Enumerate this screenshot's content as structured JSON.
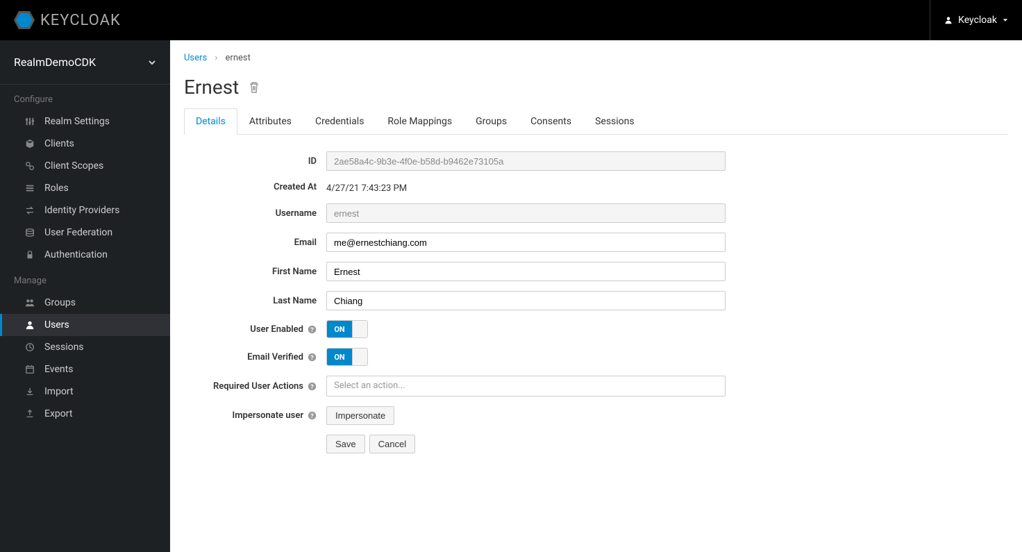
{
  "header": {
    "brand": "KEYCLOAK",
    "user_label": "Keycloak"
  },
  "sidebar": {
    "realm": "RealmDemoCDK",
    "sections": [
      {
        "title": "Configure",
        "items": [
          {
            "label": "Realm Settings",
            "icon": "sliders"
          },
          {
            "label": "Clients",
            "icon": "cube"
          },
          {
            "label": "Client Scopes",
            "icon": "link"
          },
          {
            "label": "Roles",
            "icon": "list"
          },
          {
            "label": "Identity Providers",
            "icon": "exchange"
          },
          {
            "label": "User Federation",
            "icon": "database"
          },
          {
            "label": "Authentication",
            "icon": "lock"
          }
        ]
      },
      {
        "title": "Manage",
        "items": [
          {
            "label": "Groups",
            "icon": "users"
          },
          {
            "label": "Users",
            "icon": "user",
            "active": true
          },
          {
            "label": "Sessions",
            "icon": "clock"
          },
          {
            "label": "Events",
            "icon": "calendar"
          },
          {
            "label": "Import",
            "icon": "import"
          },
          {
            "label": "Export",
            "icon": "export"
          }
        ]
      }
    ]
  },
  "breadcrumb": {
    "parent": "Users",
    "current": "ernest"
  },
  "page": {
    "title": "Ernest"
  },
  "tabs": [
    {
      "label": "Details",
      "active": true
    },
    {
      "label": "Attributes"
    },
    {
      "label": "Credentials"
    },
    {
      "label": "Role Mappings"
    },
    {
      "label": "Groups"
    },
    {
      "label": "Consents"
    },
    {
      "label": "Sessions"
    }
  ],
  "form": {
    "labels": {
      "id": "ID",
      "created_at": "Created At",
      "username": "Username",
      "email": "Email",
      "first_name": "First Name",
      "last_name": "Last Name",
      "user_enabled": "User Enabled",
      "email_verified": "Email Verified",
      "required_actions": "Required User Actions",
      "impersonate": "Impersonate user"
    },
    "values": {
      "id": "2ae58a4c-9b3e-4f0e-b58d-b9462e73105a",
      "created_at": "4/27/21 7:43:23 PM",
      "username": "ernest",
      "email": "me@ernestchiang.com",
      "first_name": "Ernest",
      "last_name": "Chiang",
      "user_enabled": "ON",
      "email_verified": "ON",
      "required_actions_placeholder": "Select an action..."
    },
    "buttons": {
      "impersonate": "Impersonate",
      "save": "Save",
      "cancel": "Cancel"
    }
  }
}
